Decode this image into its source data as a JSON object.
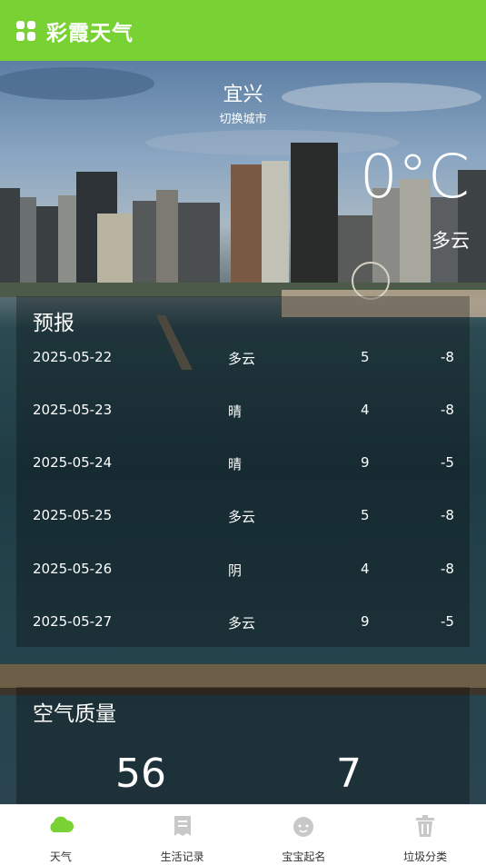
{
  "header": {
    "title": "彩霞天气"
  },
  "weather": {
    "city": "宜兴",
    "switch_city": "切换城市",
    "temperature": "0°C",
    "condition": "多云"
  },
  "forecast": {
    "title": "预报",
    "rows": [
      {
        "date": "2025-05-22",
        "cond": "多云",
        "high": "5",
        "low": "-8"
      },
      {
        "date": "2025-05-23",
        "cond": "晴",
        "high": "4",
        "low": "-8"
      },
      {
        "date": "2025-05-24",
        "cond": "晴",
        "high": "9",
        "low": "-5"
      },
      {
        "date": "2025-05-25",
        "cond": "多云",
        "high": "5",
        "low": "-8"
      },
      {
        "date": "2025-05-26",
        "cond": "阴",
        "high": "4",
        "low": "-8"
      },
      {
        "date": "2025-05-27",
        "cond": "多云",
        "high": "9",
        "low": "-5"
      }
    ]
  },
  "air_quality": {
    "title": "空气质量",
    "aqi_value": "56",
    "pm25_value": "7"
  },
  "bottom_nav": {
    "items": [
      {
        "label": "天气",
        "icon": "cloud-icon",
        "active": true
      },
      {
        "label": "生活记录",
        "icon": "note-icon",
        "active": false
      },
      {
        "label": "宝宝起名",
        "icon": "baby-icon",
        "active": false
      },
      {
        "label": "垃圾分类",
        "icon": "trash-icon",
        "active": false
      }
    ]
  },
  "colors": {
    "accent": "#79d234",
    "inactive_icon": "#c8c8c8"
  }
}
